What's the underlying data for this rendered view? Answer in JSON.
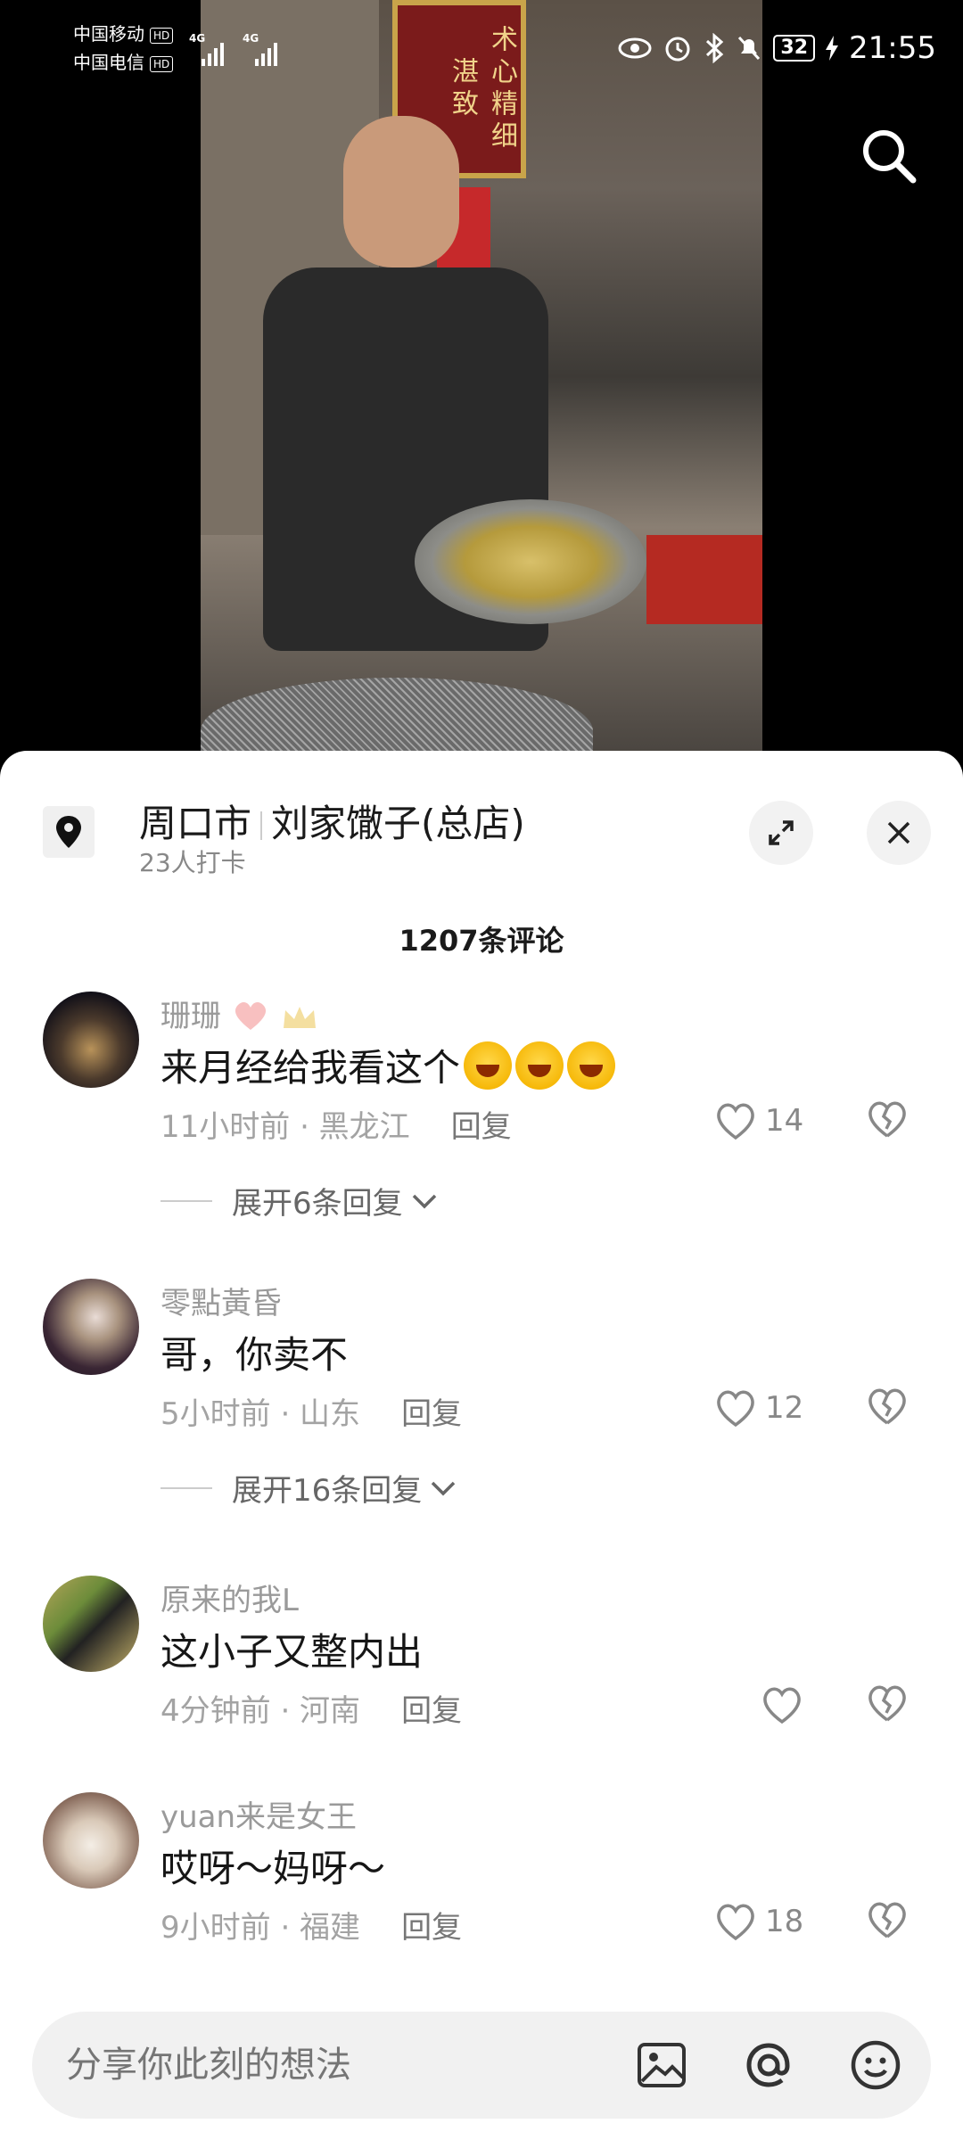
{
  "status_bar": {
    "carrier1": "中国移动",
    "carrier2": "中国电信",
    "hd": "HD",
    "network1": "4G",
    "network2": "4G",
    "battery": "32",
    "time": "21:55"
  },
  "video": {
    "banner_text": "术心精细湛致"
  },
  "location": {
    "city": "周口市",
    "shop": "刘家馓子(总店)",
    "checkins": "23人打卡"
  },
  "comments_count": "1207条评论",
  "comments": [
    {
      "username": "珊珊",
      "text": "来月经给我看这个",
      "time_location": "11小时前 · 黑龙江",
      "reply": "回复",
      "likes": "14",
      "expand": "展开6条回复"
    },
    {
      "username": "零點黃昏",
      "text": "哥，你卖不",
      "time_location": "5小时前 · 山东",
      "reply": "回复",
      "likes": "12",
      "expand": "展开16条回复"
    },
    {
      "username": "原来的我L",
      "text": "这小子又整内出",
      "time_location": "4分钟前 · 河南",
      "reply": "回复",
      "likes": ""
    },
    {
      "username": "yuan来是女王",
      "text": "哎呀～妈呀～",
      "time_location": "9小时前 · 福建",
      "reply": "回复",
      "likes": "18"
    }
  ],
  "input": {
    "placeholder": "分享你此刻的想法"
  },
  "icons": {
    "search": "search-icon",
    "location": "location-pin-icon",
    "expand": "expand-icon",
    "close": "close-icon",
    "like": "heart-icon",
    "dislike": "broken-heart-icon",
    "image": "image-icon",
    "mention": "at-icon",
    "emoji": "smiley-icon"
  }
}
